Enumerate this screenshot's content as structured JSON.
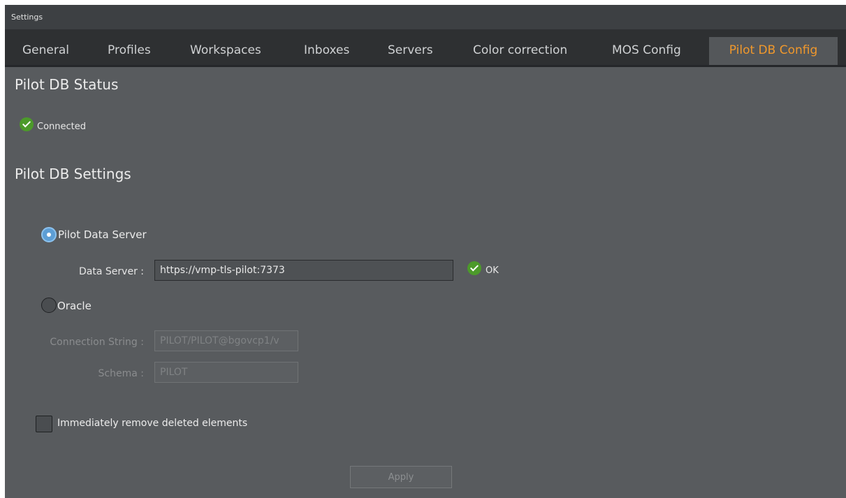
{
  "window": {
    "title": "Settings"
  },
  "tabs": [
    {
      "label": "General"
    },
    {
      "label": "Profiles"
    },
    {
      "label": "Workspaces"
    },
    {
      "label": "Inboxes"
    },
    {
      "label": "Servers"
    },
    {
      "label": "Color correction"
    },
    {
      "label": "MOS Config"
    },
    {
      "label": "Pilot DB Config",
      "active": true
    }
  ],
  "status": {
    "heading": "Pilot DB Status",
    "icon": "check-circle-icon",
    "text": "Connected"
  },
  "settings": {
    "heading": "Pilot DB Settings",
    "pilot_data_server": {
      "option_label": "Pilot Data Server",
      "selected": true,
      "field_label": "Data Server :",
      "value": "https://vmp-tls-pilot:7373",
      "status_text": "OK"
    },
    "oracle": {
      "option_label": "Oracle",
      "selected": false,
      "connection_label": "Connection String :",
      "connection_value": "PILOT/PILOT@bgovcp1/v",
      "schema_label": "Schema :",
      "schema_value": "PILOT"
    },
    "remove_deleted": {
      "label": "Immediately remove deleted elements",
      "checked": false
    },
    "apply_label": "Apply"
  },
  "colors": {
    "accent": "#f0982c",
    "ok_green": "#4c9a2a",
    "radio_blue": "#5d9ed5",
    "panel": "#585b5e"
  }
}
